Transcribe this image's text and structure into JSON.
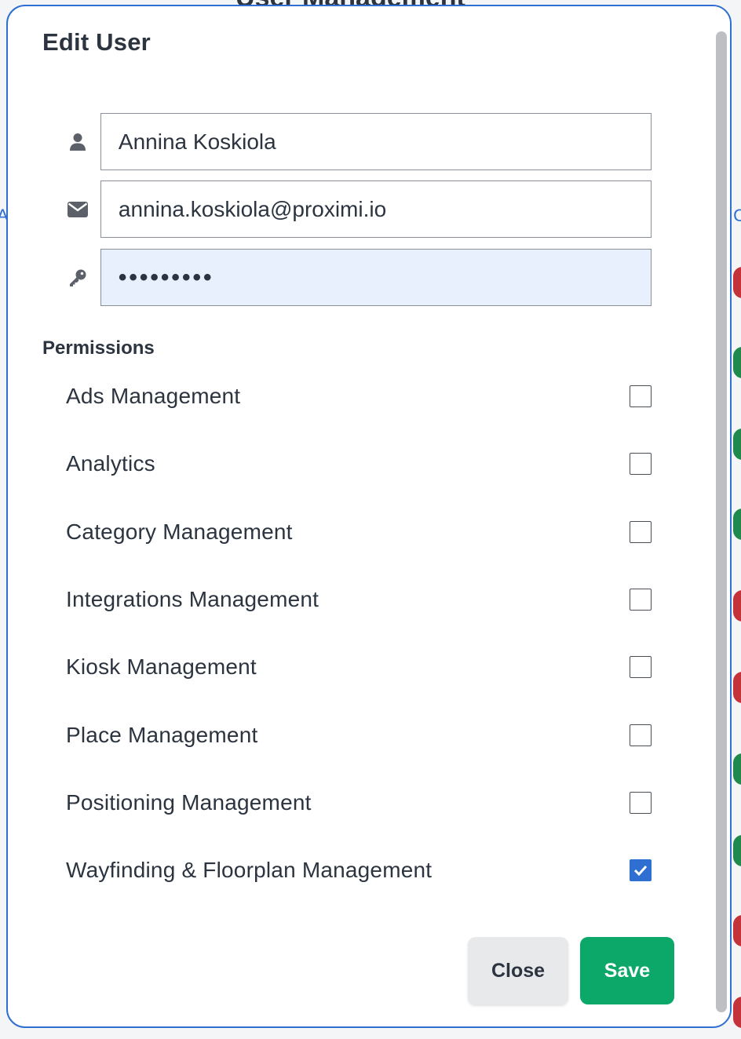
{
  "background": {
    "page_title": "User Management",
    "left_fragment": "A",
    "right_fragment": "C"
  },
  "modal": {
    "title": "Edit User",
    "fields": {
      "name": {
        "value": "Annina Koskiola",
        "icon": "user-icon"
      },
      "email": {
        "value": "annina.koskiola@proximi.io",
        "icon": "envelope-icon"
      },
      "password": {
        "value": "•••••••••",
        "icon": "key-icon"
      }
    },
    "permissions_label": "Permissions",
    "permissions": [
      {
        "label": "Ads Management",
        "checked": false
      },
      {
        "label": "Analytics",
        "checked": false
      },
      {
        "label": "Category Management",
        "checked": false
      },
      {
        "label": "Integrations Management",
        "checked": false
      },
      {
        "label": "Kiosk Management",
        "checked": false
      },
      {
        "label": "Place Management",
        "checked": false
      },
      {
        "label": "Positioning Management",
        "checked": false
      },
      {
        "label": "Wayfinding & Floorplan Management",
        "checked": true
      }
    ],
    "buttons": {
      "close": "Close",
      "save": "Save"
    }
  },
  "colors": {
    "accent": "#2f6fd1",
    "save": "#0ba86a",
    "text": "#2c3440",
    "password_bg": "#e8f0fe"
  }
}
